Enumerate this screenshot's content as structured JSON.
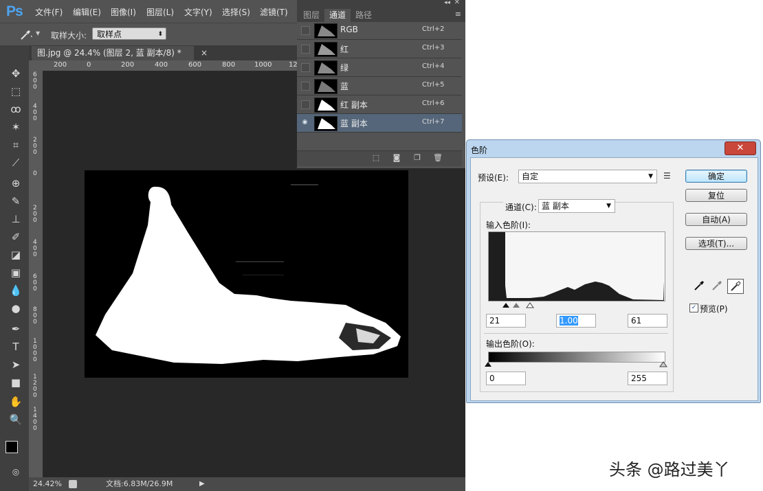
{
  "app": {
    "logo": "Ps",
    "menu": [
      "文件(F)",
      "编辑(E)",
      "图像(I)",
      "图层(L)",
      "文字(Y)",
      "选择(S)",
      "滤镜(T)"
    ]
  },
  "options_bar": {
    "sample_size_label": "取样大小:",
    "sample_size_value": "取样点"
  },
  "document": {
    "tab_title": "图.jpg @ 24.4% (图层 2, 蓝 副本/8) *",
    "close_glyph": "×",
    "ruler_top_ticks": [
      "200",
      "0",
      "200",
      "400",
      "600",
      "800",
      "1000",
      "12"
    ],
    "ruler_left_ticks": [
      "6\n0\n0",
      "4\n0\n0",
      "2\n0\n0",
      "0",
      "2\n0\n0",
      "4\n0\n0",
      "6\n0\n0",
      "8\n0\n0",
      "1\n0\n0\n0",
      "1\n2\n0\n0",
      "1\n4\n0\n0"
    ],
    "zoom": "24.42%",
    "doc_info": "文档:6.83M/26.9M"
  },
  "channels_panel": {
    "tabs": [
      "图层",
      "通道",
      "路径"
    ],
    "active_tab": 1,
    "channels": [
      {
        "name": "RGB",
        "shortcut": "Ctrl+2",
        "visible": false,
        "selected": false
      },
      {
        "name": "红",
        "shortcut": "Ctrl+3",
        "visible": false,
        "selected": false
      },
      {
        "name": "绿",
        "shortcut": "Ctrl+4",
        "visible": false,
        "selected": false
      },
      {
        "name": "蓝",
        "shortcut": "Ctrl+5",
        "visible": false,
        "selected": false
      },
      {
        "name": "红 副本",
        "shortcut": "Ctrl+6",
        "visible": false,
        "selected": false
      },
      {
        "name": "蓝 副本",
        "shortcut": "Ctrl+7",
        "visible": true,
        "selected": true
      }
    ]
  },
  "levels_dialog": {
    "title": "色阶",
    "close_glyph": "✕",
    "preset_label": "预设(E):",
    "preset_value": "自定",
    "channel_label": "通道(C):",
    "channel_value": "蓝 副本",
    "input_levels_label": "输入色阶(I):",
    "input_black": "21",
    "input_gamma": "1.00",
    "input_white": "61",
    "output_levels_label": "输出色阶(O):",
    "output_black": "0",
    "output_white": "255",
    "buttons": {
      "ok": "确定",
      "reset": "复位",
      "auto": "自动(A)",
      "options": "选项(T)..."
    },
    "preview_label": "预览(P)",
    "preview_checked": true,
    "check_glyph": "✓"
  },
  "watermark": "头条 @路过美丫"
}
